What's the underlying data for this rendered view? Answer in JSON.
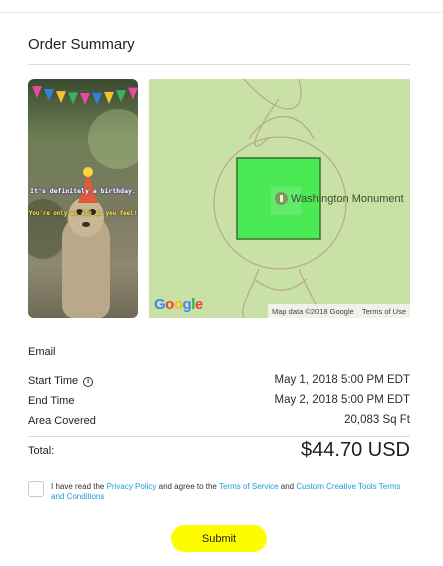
{
  "header": {
    "title": "Order Summary"
  },
  "preview": {
    "line1": "It's definitely a birthday.",
    "line2": "You're only as old as you feel!",
    "flag_colors": [
      "#e74b9b",
      "#2e84d6",
      "#f2c230",
      "#3bb35c",
      "#e74b9b",
      "#2e84d6",
      "#f2c230",
      "#3bb35c",
      "#e74b9b"
    ]
  },
  "map": {
    "place_label": "Washington Monument",
    "logo": {
      "G": "G",
      "o1": "o",
      "o2": "o",
      "g": "g",
      "l": "l",
      "e": "e"
    },
    "attribution": "Map data ©2018 Google",
    "terms": "Terms of Use",
    "colors": {
      "fill": "#4bea55",
      "stroke": "#3a6f31",
      "background": "#c9e1a6"
    }
  },
  "summary": {
    "email_label": "Email",
    "start_label": "Start Time",
    "start_value": "May 1, 2018 5:00 PM  EDT",
    "end_label": "End Time",
    "end_value": "May 2, 2018 5:00 PM  EDT",
    "area_label": "Area Covered",
    "area_value": "20,083 Sq Ft",
    "total_label": "Total:",
    "total_value": "$44.70 USD"
  },
  "agreement": {
    "t1": "I have read the ",
    "privacy": "Privacy Policy",
    "t2": " and agree to the ",
    "tos": "Terms of Service",
    "t3": " and ",
    "custom": "Custom Creative Tools Terms and Conditions"
  },
  "submit": {
    "label": "Submit",
    "color": "#fffc00"
  }
}
